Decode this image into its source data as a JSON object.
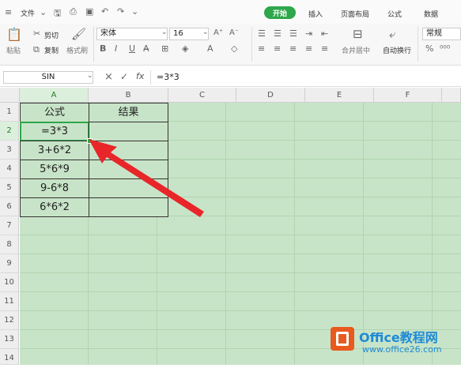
{
  "menu": {
    "file": "文件",
    "tabs": [
      "开始",
      "插入",
      "页面布局",
      "公式",
      "数据"
    ],
    "active_tab_color": "#2ea64a"
  },
  "ribbon": {
    "cut": "剪切",
    "copy": "复制",
    "paste": "粘贴",
    "format_painter": "格式刷",
    "font_name": "宋体",
    "font_size": "16",
    "merge_center": "合并居中",
    "wrap_text": "自动换行",
    "number_format": "常规"
  },
  "formula_bar": {
    "name_box": "SIN",
    "fx": "fx",
    "formula": "=3*3"
  },
  "columns": [
    "A",
    "B",
    "C",
    "D",
    "E",
    "F"
  ],
  "rows": [
    "1",
    "2",
    "3",
    "4",
    "5",
    "6",
    "7",
    "8",
    "9",
    "10",
    "11",
    "12",
    "13",
    "14"
  ],
  "table": {
    "headers": [
      "公式",
      "结果"
    ],
    "cells": [
      "=3*3",
      "3+6*2",
      "5*6*9",
      "9-6*8",
      "6*6*2"
    ]
  },
  "watermark": {
    "brand": "Office教程网",
    "url": "www.office26.com"
  }
}
